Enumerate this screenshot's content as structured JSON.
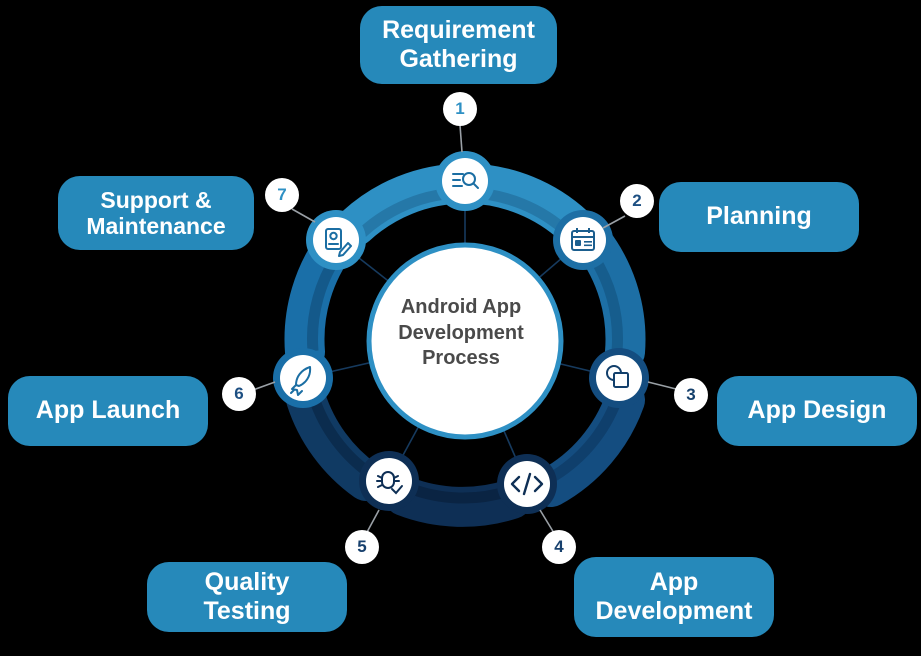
{
  "diagram": {
    "title": "Android App Development Process",
    "hub": {
      "line1": "Android App",
      "line2": "Development",
      "line3": "Process",
      "text_color": "#4a4a4a",
      "fill": "#ffffff",
      "stroke": "#2e90c4"
    },
    "background": "#000000",
    "pill_color": "#2689ba",
    "pill_text_color": "#ffffff",
    "connector_color": "#9aa0a6",
    "steps": [
      {
        "number": "1",
        "label": "Requirement Gathering",
        "label_lines": [
          "Requirement",
          "Gathering"
        ],
        "icon": "list-search-icon",
        "segment_color": "#2e90c4",
        "segment_inner_color": "#2578a8",
        "badge_text_color": "#2e90c4",
        "icon_color": "#1b6ea3"
      },
      {
        "number": "2",
        "label": "Planning",
        "label_lines": [
          "Planning"
        ],
        "icon": "calendar-icon",
        "segment_color": "#1d6fa5",
        "segment_inner_color": "#165d8d",
        "badge_text_color": "#1d4f82",
        "icon_color": "#1b5e8e"
      },
      {
        "number": "3",
        "label": "App Design",
        "label_lines": [
          "App Design"
        ],
        "icon": "shapes-design-icon",
        "segment_color": "#144d80",
        "segment_inner_color": "#0f3f6c",
        "badge_text_color": "#143f6b",
        "icon_color": "#123f6b"
      },
      {
        "number": "4",
        "label": "App Development",
        "label_lines": [
          "App",
          "Development"
        ],
        "icon": "code-tag-icon",
        "segment_color": "#0e2f55",
        "segment_inner_color": "#0a2443",
        "badge_text_color": "#17406d",
        "icon_color": "#0e2f55"
      },
      {
        "number": "5",
        "label": "Quality Testing",
        "label_lines": [
          "Quality Testing"
        ],
        "icon": "bug-check-icon",
        "segment_color": "#0e2f55",
        "segment_inner_color": "#0a2443",
        "badge_text_color": "#17406d",
        "icon_color": "#0e2f55"
      },
      {
        "number": "6",
        "label": "App Launch",
        "label_lines": [
          "App Launch"
        ],
        "icon": "rocket-icon",
        "segment_color": "#1a6fa8",
        "segment_inner_color": "#14598a",
        "badge_text_color": "#1d4f82",
        "icon_color": "#1b6ea3"
      },
      {
        "number": "7",
        "label": "Support & Maintenance",
        "label_lines": [
          "Support &",
          "Maintenance"
        ],
        "icon": "document-gear-pencil-icon",
        "segment_color": "#2e90c4",
        "segment_inner_color": "#2578a8",
        "badge_text_color": "#2e90c4",
        "icon_color": "#1b6ea3"
      }
    ]
  }
}
